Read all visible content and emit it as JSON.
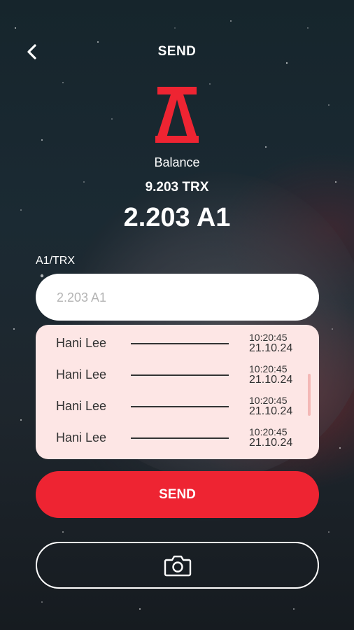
{
  "header": {
    "title": "SEND"
  },
  "colors": {
    "accent": "#ee2432",
    "history_bg": "#fde6e5"
  },
  "balance": {
    "label": "Balance",
    "trx_amount": "9.203 TRX",
    "a1_amount": "2.203 A1"
  },
  "pair_label": "A1/TRX",
  "amount_input": {
    "placeholder": "2.203 A1",
    "value": ""
  },
  "history": [
    {
      "name": "Hani Lee",
      "time": "10:20:45",
      "date": "21.10.24"
    },
    {
      "name": "Hani Lee",
      "time": "10:20:45",
      "date": "21.10.24"
    },
    {
      "name": "Hani Lee",
      "time": "10:20:45",
      "date": "21.10.24"
    },
    {
      "name": "Hani Lee",
      "time": "10:20:45",
      "date": "21.10.24"
    }
  ],
  "send_button": {
    "label": "SEND"
  },
  "icons": {
    "back": "chevron-left-icon",
    "camera": "camera-icon",
    "logo": "a1-logo"
  }
}
